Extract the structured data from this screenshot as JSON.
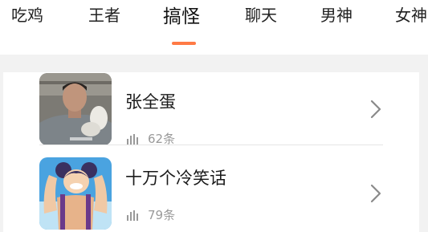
{
  "tabs": [
    {
      "label": "吃鸡"
    },
    {
      "label": "王者"
    },
    {
      "label": "搞怪",
      "active": true
    },
    {
      "label": "聊天"
    },
    {
      "label": "男神"
    },
    {
      "label": "女神"
    }
  ],
  "accent_color": "#ff7a45",
  "list": [
    {
      "title": "张全蛋",
      "count": "62条",
      "thumbnail": "man-in-white-gloves-photo"
    },
    {
      "title": "十万个冷笑话",
      "count": "79条",
      "thumbnail": "cartoon-muscular-character"
    }
  ],
  "icons": {
    "stat": "bar-chart-icon",
    "chevron": "chevron-right-icon"
  }
}
